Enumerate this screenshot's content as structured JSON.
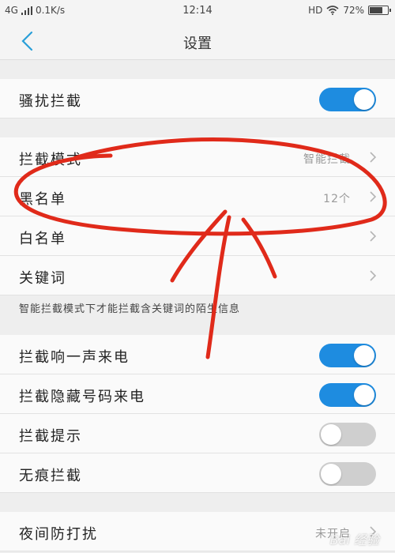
{
  "status_bar": {
    "network": "4G",
    "speed": "0.1K/s",
    "time": "12:14",
    "hd": "HD",
    "battery": "72%",
    "battery_level": 0.72
  },
  "header": {
    "title": "设置"
  },
  "sections": {
    "harassment": {
      "label": "骚扰拦截",
      "toggle_on": true
    },
    "mode": {
      "label": "拦截模式",
      "value": "智能拦截"
    },
    "blacklist": {
      "label": "黑名单",
      "value": "12个"
    },
    "whitelist": {
      "label": "白名单"
    },
    "keywords": {
      "label": "关键词"
    },
    "keywords_note": "智能拦截模式下才能拦截含关键词的陌生信息",
    "toggles": [
      {
        "label": "拦截响一声来电",
        "on": true
      },
      {
        "label": "拦截隐藏号码来电",
        "on": true
      },
      {
        "label": "拦截提示",
        "on": false
      },
      {
        "label": "无痕拦截",
        "on": false
      }
    ],
    "night": {
      "label": "夜间防打扰",
      "value": "未开启"
    }
  },
  "watermark": "Bai 经验",
  "colors": {
    "accent": "#1e8ce0",
    "annotation": "#e02a1a"
  }
}
